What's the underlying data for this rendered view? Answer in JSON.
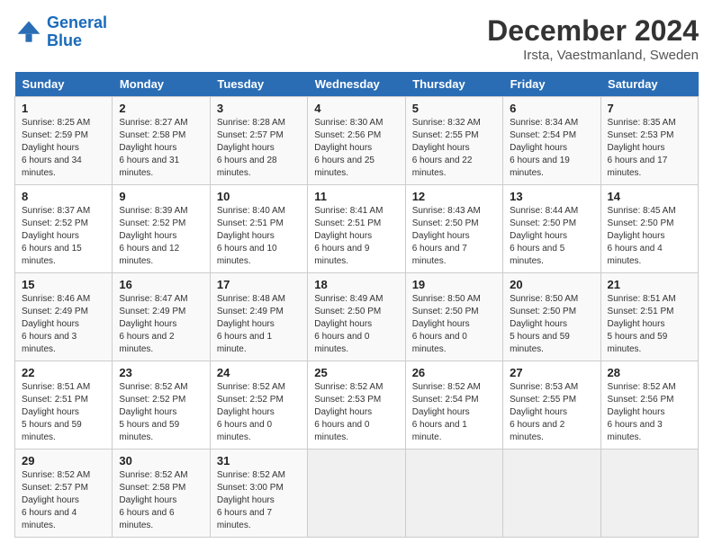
{
  "logo": {
    "line1": "General",
    "line2": "Blue"
  },
  "title": "December 2024",
  "subtitle": "Irsta, Vaestmanland, Sweden",
  "weekdays": [
    "Sunday",
    "Monday",
    "Tuesday",
    "Wednesday",
    "Thursday",
    "Friday",
    "Saturday"
  ],
  "weeks": [
    [
      {
        "day": "1",
        "sunrise": "8:25 AM",
        "sunset": "2:59 PM",
        "daylight": "6 hours and 34 minutes."
      },
      {
        "day": "2",
        "sunrise": "8:27 AM",
        "sunset": "2:58 PM",
        "daylight": "6 hours and 31 minutes."
      },
      {
        "day": "3",
        "sunrise": "8:28 AM",
        "sunset": "2:57 PM",
        "daylight": "6 hours and 28 minutes."
      },
      {
        "day": "4",
        "sunrise": "8:30 AM",
        "sunset": "2:56 PM",
        "daylight": "6 hours and 25 minutes."
      },
      {
        "day": "5",
        "sunrise": "8:32 AM",
        "sunset": "2:55 PM",
        "daylight": "6 hours and 22 minutes."
      },
      {
        "day": "6",
        "sunrise": "8:34 AM",
        "sunset": "2:54 PM",
        "daylight": "6 hours and 19 minutes."
      },
      {
        "day": "7",
        "sunrise": "8:35 AM",
        "sunset": "2:53 PM",
        "daylight": "6 hours and 17 minutes."
      }
    ],
    [
      {
        "day": "8",
        "sunrise": "8:37 AM",
        "sunset": "2:52 PM",
        "daylight": "6 hours and 15 minutes."
      },
      {
        "day": "9",
        "sunrise": "8:39 AM",
        "sunset": "2:52 PM",
        "daylight": "6 hours and 12 minutes."
      },
      {
        "day": "10",
        "sunrise": "8:40 AM",
        "sunset": "2:51 PM",
        "daylight": "6 hours and 10 minutes."
      },
      {
        "day": "11",
        "sunrise": "8:41 AM",
        "sunset": "2:51 PM",
        "daylight": "6 hours and 9 minutes."
      },
      {
        "day": "12",
        "sunrise": "8:43 AM",
        "sunset": "2:50 PM",
        "daylight": "6 hours and 7 minutes."
      },
      {
        "day": "13",
        "sunrise": "8:44 AM",
        "sunset": "2:50 PM",
        "daylight": "6 hours and 5 minutes."
      },
      {
        "day": "14",
        "sunrise": "8:45 AM",
        "sunset": "2:50 PM",
        "daylight": "6 hours and 4 minutes."
      }
    ],
    [
      {
        "day": "15",
        "sunrise": "8:46 AM",
        "sunset": "2:49 PM",
        "daylight": "6 hours and 3 minutes."
      },
      {
        "day": "16",
        "sunrise": "8:47 AM",
        "sunset": "2:49 PM",
        "daylight": "6 hours and 2 minutes."
      },
      {
        "day": "17",
        "sunrise": "8:48 AM",
        "sunset": "2:49 PM",
        "daylight": "6 hours and 1 minute."
      },
      {
        "day": "18",
        "sunrise": "8:49 AM",
        "sunset": "2:50 PM",
        "daylight": "6 hours and 0 minutes."
      },
      {
        "day": "19",
        "sunrise": "8:50 AM",
        "sunset": "2:50 PM",
        "daylight": "6 hours and 0 minutes."
      },
      {
        "day": "20",
        "sunrise": "8:50 AM",
        "sunset": "2:50 PM",
        "daylight": "5 hours and 59 minutes."
      },
      {
        "day": "21",
        "sunrise": "8:51 AM",
        "sunset": "2:51 PM",
        "daylight": "5 hours and 59 minutes."
      }
    ],
    [
      {
        "day": "22",
        "sunrise": "8:51 AM",
        "sunset": "2:51 PM",
        "daylight": "5 hours and 59 minutes."
      },
      {
        "day": "23",
        "sunrise": "8:52 AM",
        "sunset": "2:52 PM",
        "daylight": "5 hours and 59 minutes."
      },
      {
        "day": "24",
        "sunrise": "8:52 AM",
        "sunset": "2:52 PM",
        "daylight": "6 hours and 0 minutes."
      },
      {
        "day": "25",
        "sunrise": "8:52 AM",
        "sunset": "2:53 PM",
        "daylight": "6 hours and 0 minutes."
      },
      {
        "day": "26",
        "sunrise": "8:52 AM",
        "sunset": "2:54 PM",
        "daylight": "6 hours and 1 minute."
      },
      {
        "day": "27",
        "sunrise": "8:53 AM",
        "sunset": "2:55 PM",
        "daylight": "6 hours and 2 minutes."
      },
      {
        "day": "28",
        "sunrise": "8:52 AM",
        "sunset": "2:56 PM",
        "daylight": "6 hours and 3 minutes."
      }
    ],
    [
      {
        "day": "29",
        "sunrise": "8:52 AM",
        "sunset": "2:57 PM",
        "daylight": "6 hours and 4 minutes."
      },
      {
        "day": "30",
        "sunrise": "8:52 AM",
        "sunset": "2:58 PM",
        "daylight": "6 hours and 6 minutes."
      },
      {
        "day": "31",
        "sunrise": "8:52 AM",
        "sunset": "3:00 PM",
        "daylight": "6 hours and 7 minutes."
      },
      null,
      null,
      null,
      null
    ]
  ]
}
